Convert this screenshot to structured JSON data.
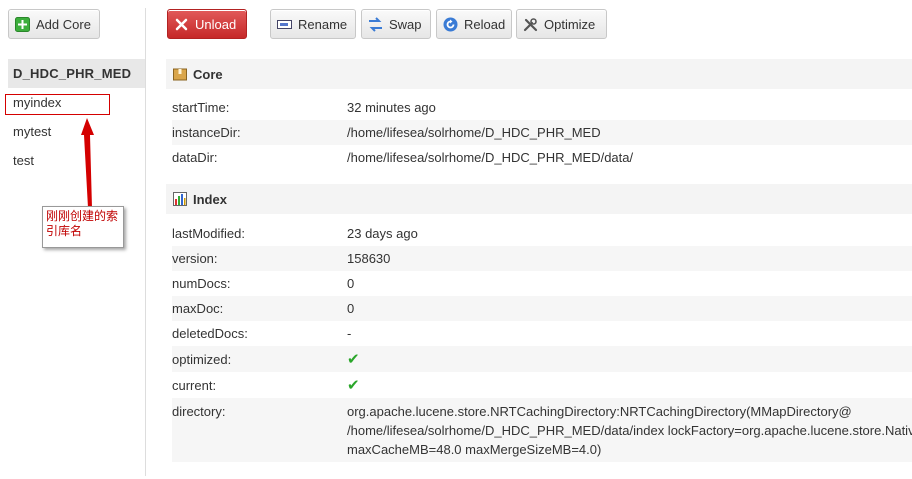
{
  "toolbar": {
    "add_core": "Add Core",
    "unload": "Unload",
    "rename": "Rename",
    "swap": "Swap",
    "reload": "Reload",
    "optimize": "Optimize"
  },
  "cores": [
    {
      "label": "D_HDC_PHR_MED",
      "selected": true
    },
    {
      "label": "myindex"
    },
    {
      "label": "mytest"
    },
    {
      "label": "test"
    }
  ],
  "annotation": {
    "line1": "刚刚创建的索",
    "line2": "引库名"
  },
  "core_section": {
    "title": "Core",
    "rows": [
      {
        "key": "startTime:",
        "value": "32 minutes ago"
      },
      {
        "key": "instanceDir:",
        "value": "/home/lifesea/solrhome/D_HDC_PHR_MED"
      },
      {
        "key": "dataDir:",
        "value": "/home/lifesea/solrhome/D_HDC_PHR_MED/data/"
      }
    ]
  },
  "index_section": {
    "title": "Index",
    "rows": [
      {
        "key": "lastModified:",
        "value": "23 days ago"
      },
      {
        "key": "version:",
        "value": "158630"
      },
      {
        "key": "numDocs:",
        "value": "0"
      },
      {
        "key": "maxDoc:",
        "value": "0"
      },
      {
        "key": "deletedDocs:",
        "value": "-"
      },
      {
        "key": "optimized:",
        "value": "✔"
      },
      {
        "key": "current:",
        "value": "✔"
      }
    ],
    "directory_key": "directory:",
    "directory_lines": [
      "org.apache.lucene.store.NRTCachingDirectory:NRTCachingDirectory(MMapDirectory@",
      "/home/lifesea/solrhome/D_HDC_PHR_MED/data/index lockFactory=org.apache.lucene.store.NativeFSLockFactory",
      "maxCacheMB=48.0 maxMergeSizeMB=4.0)"
    ]
  },
  "colors": {
    "unload": "#c62828",
    "check": "#2aa62a",
    "annotation": "#c00000"
  }
}
